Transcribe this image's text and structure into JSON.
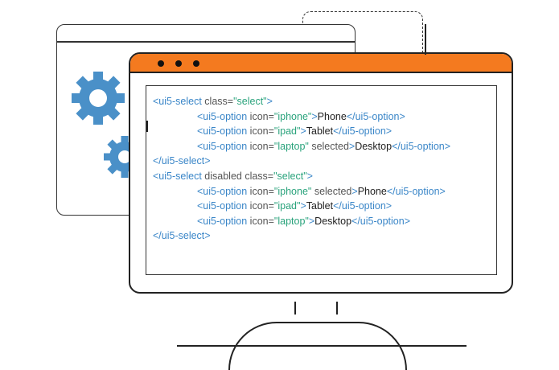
{
  "code": {
    "lines": [
      {
        "indent": false,
        "parts": [
          {
            "t": "tag",
            "v": "<ui5-select"
          },
          {
            "t": "attr",
            "v": " class="
          },
          {
            "t": "str",
            "v": "\"select\""
          },
          {
            "t": "tag",
            "v": ">"
          }
        ]
      },
      {
        "indent": true,
        "parts": [
          {
            "t": "tag",
            "v": "<ui5-option"
          },
          {
            "t": "attr",
            "v": " icon="
          },
          {
            "t": "str",
            "v": "\"iphone\""
          },
          {
            "t": "tag",
            "v": ">"
          },
          {
            "t": "txt",
            "v": "Phone"
          },
          {
            "t": "tag",
            "v": "</ui5-option>"
          }
        ]
      },
      {
        "indent": true,
        "parts": [
          {
            "t": "tag",
            "v": "<ui5-option"
          },
          {
            "t": "attr",
            "v": " icon="
          },
          {
            "t": "str",
            "v": "\"ipad\""
          },
          {
            "t": "tag",
            "v": ">"
          },
          {
            "t": "txt",
            "v": "Tablet"
          },
          {
            "t": "tag",
            "v": "</ui5-option>"
          }
        ]
      },
      {
        "indent": true,
        "parts": [
          {
            "t": "tag",
            "v": "<ui5-option"
          },
          {
            "t": "attr",
            "v": " icon="
          },
          {
            "t": "str",
            "v": "\"laptop\""
          },
          {
            "t": "attr",
            "v": " selected"
          },
          {
            "t": "tag",
            "v": ">"
          },
          {
            "t": "txt",
            "v": "Desktop"
          },
          {
            "t": "tag",
            "v": "</ui5-option>"
          }
        ]
      },
      {
        "indent": false,
        "parts": [
          {
            "t": "tag",
            "v": "</ui5-select>"
          }
        ]
      },
      {
        "indent": false,
        "parts": [
          {
            "t": "tag",
            "v": "<ui5-select"
          },
          {
            "t": "attr",
            "v": " disabled class="
          },
          {
            "t": "str",
            "v": "\"select\""
          },
          {
            "t": "tag",
            "v": ">"
          }
        ]
      },
      {
        "indent": true,
        "parts": [
          {
            "t": "tag",
            "v": "<ui5-option"
          },
          {
            "t": "attr",
            "v": " icon="
          },
          {
            "t": "str",
            "v": "\"iphone\""
          },
          {
            "t": "attr",
            "v": " selected"
          },
          {
            "t": "tag",
            "v": ">"
          },
          {
            "t": "txt",
            "v": "Phone"
          },
          {
            "t": "tag",
            "v": "</ui5-option>"
          }
        ]
      },
      {
        "indent": true,
        "parts": [
          {
            "t": "tag",
            "v": "<ui5-option"
          },
          {
            "t": "attr",
            "v": " icon="
          },
          {
            "t": "str",
            "v": "\"ipad\""
          },
          {
            "t": "tag",
            "v": ">"
          },
          {
            "t": "txt",
            "v": "Tablet"
          },
          {
            "t": "tag",
            "v": "</ui5-option>"
          }
        ]
      },
      {
        "indent": true,
        "parts": [
          {
            "t": "tag",
            "v": "<ui5-option"
          },
          {
            "t": "attr",
            "v": " icon="
          },
          {
            "t": "str",
            "v": "\"laptop\""
          },
          {
            "t": "tag",
            "v": ">"
          },
          {
            "t": "txt",
            "v": "Desktop"
          },
          {
            "t": "tag",
            "v": "</ui5-option>"
          }
        ]
      },
      {
        "indent": false,
        "parts": [
          {
            "t": "tag",
            "v": "</ui5-select>"
          }
        ]
      }
    ]
  },
  "colors": {
    "monitor_bar": "#f47a1f",
    "gear": "#4a90c8",
    "tag": "#3a86c8",
    "string": "#2aa37c"
  },
  "icons": [
    "gear-icon",
    "window-dots-icon"
  ]
}
